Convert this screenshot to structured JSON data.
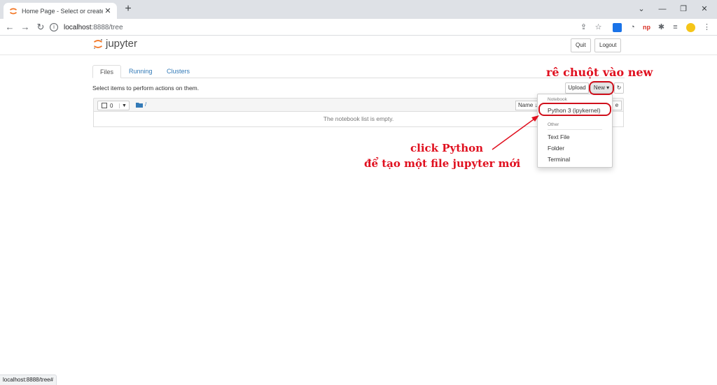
{
  "browser": {
    "tab_title": "Home Page - Select or create a n",
    "new_tab": "+",
    "url_host": "localhost",
    "url_path": ":8888/tree",
    "status_url": "localhost:8888/tree#"
  },
  "jupyter": {
    "logo_text": "jupyter",
    "quit_label": "Quit",
    "logout_label": "Logout",
    "tabs": [
      {
        "label": "Files"
      },
      {
        "label": "Running"
      },
      {
        "label": "Clusters"
      }
    ],
    "select_info": "Select items to perform actions on them.",
    "upload_label": "Upload",
    "new_label": "New",
    "selected_count": "0",
    "folder_path": "/",
    "name_label": "Name",
    "empty_list": "The notebook list is empty.",
    "menu": {
      "notebook_header": "Notebook",
      "python_item": "Python 3 (ipykernel)",
      "other_header": "Other",
      "text_file": "Text File",
      "folder": "Folder",
      "terminal": "Terminal"
    }
  },
  "annotations": {
    "hover_new": "rê chuột vào new",
    "click_python_1": "click Python",
    "click_python_2": "để tạo một file jupyter mới"
  },
  "colors": {
    "accent": "#f37726",
    "link": "#337ab7",
    "annotation": "#e0101f"
  }
}
